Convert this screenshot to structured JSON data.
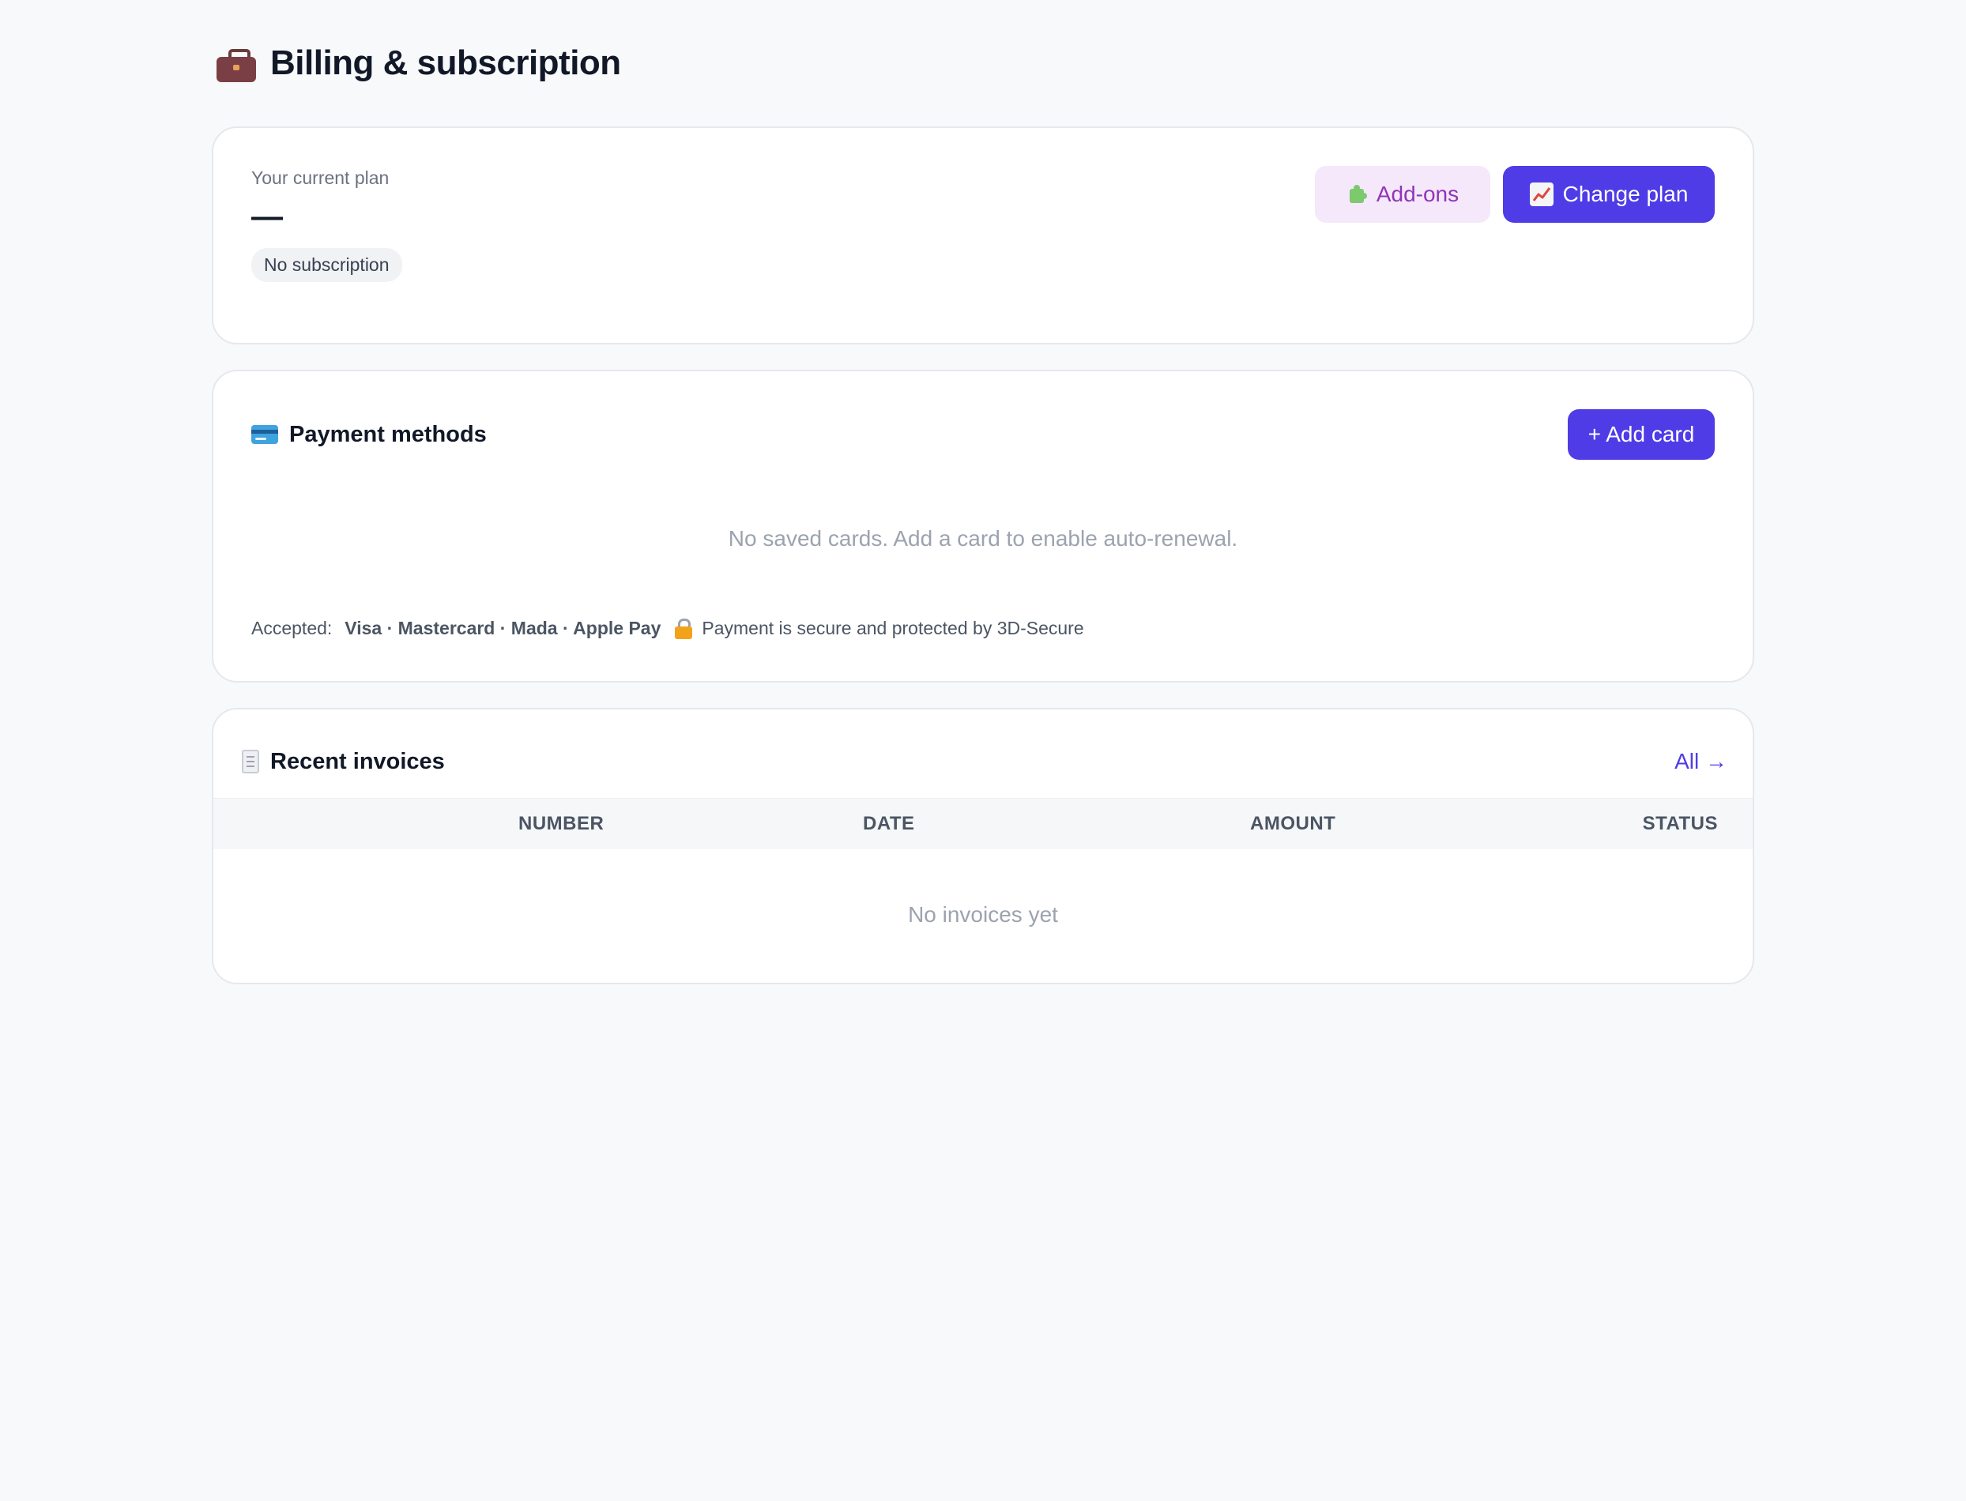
{
  "header": {
    "title": "Billing & subscription",
    "icon": "briefcase-icon"
  },
  "plan": {
    "label": "Your current plan",
    "name": "—",
    "badge": "No subscription",
    "addons_label": "Add-ons",
    "change_plan_label": "Change plan"
  },
  "payment": {
    "title": "Payment methods",
    "add_card_label": "+ Add card",
    "empty_text": "No saved cards. Add a card to enable auto-renewal.",
    "accepted_label": "Accepted:",
    "accepted_methods": "Visa · Mastercard · Mada · Apple Pay",
    "secure_text": "Payment is secure and protected by 3D-Secure"
  },
  "invoices": {
    "title": "Recent invoices",
    "all_link": "All →",
    "columns": [
      "NUMBER",
      "DATE",
      "AMOUNT",
      "STATUS"
    ],
    "empty_text": "No invoices yet"
  },
  "colors": {
    "accent": "#4f3ce6",
    "addons_bg": "#f5e8fa",
    "addons_text": "#8e35b8",
    "page_bg": "#f8f9fb"
  }
}
